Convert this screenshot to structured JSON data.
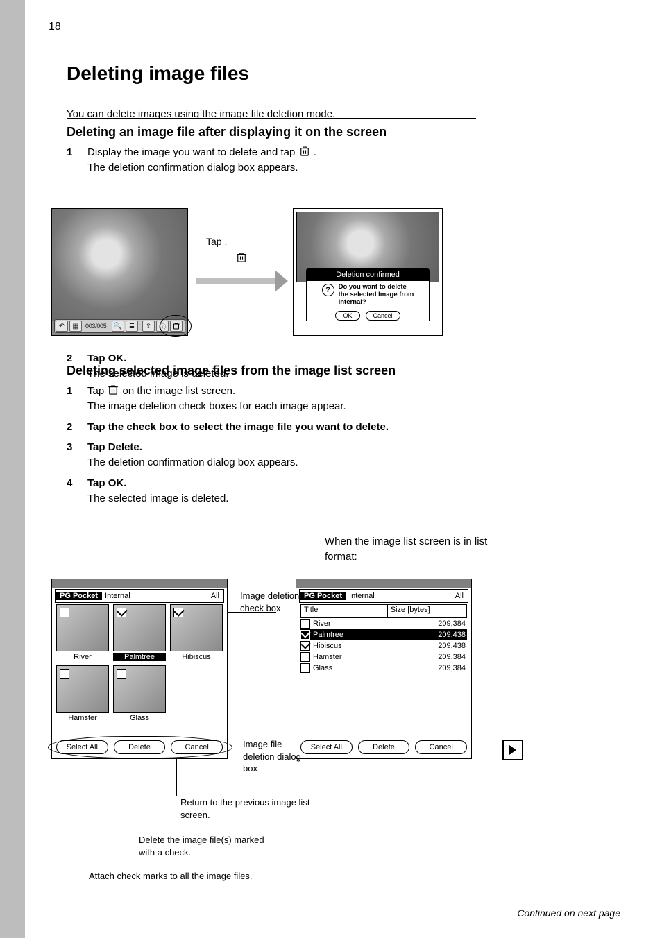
{
  "page_number": "18",
  "heading": "Deleting image files",
  "subtitle": "You can delete images using the image file deletion mode.",
  "rule_anchor": "rule",
  "section1": {
    "title": "Deleting an image file after displaying it on the screen",
    "step1_num": "1",
    "step1_text": "Display the image you want to delete and tap",
    "step1_detail": "The deletion confirmation dialog box appears.",
    "step2_num": "2",
    "step2_text": "Tap OK.",
    "step2_detail": "The selected image is deleted.",
    "arrow_label": "Tap      ."
  },
  "dialog": {
    "title": "Deletion confirmed",
    "msg_l1": "Do you want to delete",
    "msg_l2": "the selected Image from",
    "msg_l3": "Internal?",
    "ok": "OK",
    "cancel": "Cancel"
  },
  "toolbar_counter": "003/005",
  "section2": {
    "title": "Deleting selected image files from the image list screen",
    "step1_num": "1",
    "step1_text_a": "Tap",
    "step1_text_b": "on the image list screen.",
    "step1_detail": "The image deletion check boxes for each image appear.",
    "step2_num": "2",
    "step2_text": "Tap the check box to select the image file you want to delete.",
    "step3_num": "3",
    "step3_text": "Tap Delete.",
    "step3_detail": "The deletion confirmation dialog box appears.",
    "step4_num": "4",
    "step4_text": "Tap OK.",
    "step4_detail": "The selected image is deleted."
  },
  "right_intro_l1": "When the image list screen is in list",
  "right_intro_l2": "format:",
  "pda": {
    "app": "PG Pocket",
    "loc": "Internal",
    "cat": "All",
    "col_title": "Title",
    "col_size": "Size [bytes]",
    "btn_select_all": "Select All",
    "btn_delete": "Delete",
    "btn_cancel": "Cancel"
  },
  "thumbs": [
    {
      "name": "River",
      "checked": false,
      "selected": false
    },
    {
      "name": "Palmtree",
      "checked": true,
      "selected": true
    },
    {
      "name": "Hibiscus",
      "checked": true,
      "selected": false
    },
    {
      "name": "Hamster",
      "checked": false,
      "selected": false
    },
    {
      "name": "Glass",
      "checked": false,
      "selected": false
    }
  ],
  "list_rows": [
    {
      "name": "River",
      "size": "209,384",
      "checked": false,
      "selected": false
    },
    {
      "name": "Palmtree",
      "size": "209,438",
      "checked": true,
      "selected": true
    },
    {
      "name": "Hibiscus",
      "size": "209,438",
      "checked": true,
      "selected": false
    },
    {
      "name": "Hamster",
      "size": "209,384",
      "checked": false,
      "selected": false
    },
    {
      "name": "Glass",
      "size": "209,384",
      "checked": false,
      "selected": false
    }
  ],
  "callouts": {
    "imgDelCheckbox": "Image deletion check box",
    "imgDelDlg": "Image file deletion dialog box",
    "returnPrev_l1": "Return to the previous image list",
    "returnPrev_l2": "screen.",
    "deleteChecked_l1": "Delete the image file(s) marked",
    "deleteChecked_l2": "with a check.",
    "selectAll": "Attach check marks to all the image files."
  },
  "continued_text": "Continued on next page",
  "icons": {
    "trash": "trash-icon"
  }
}
